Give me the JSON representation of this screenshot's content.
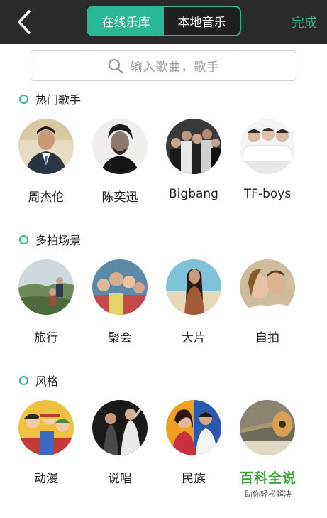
{
  "topbar": {
    "back_icon": "chevron-left-icon",
    "tabs": [
      {
        "label": "在线乐库",
        "active": true
      },
      {
        "label": "本地音乐",
        "active": false
      }
    ],
    "done_label": "完成"
  },
  "search": {
    "placeholder": "输入歌曲，歌手",
    "icon": "search-icon"
  },
  "sections": [
    {
      "title": "热门歌手",
      "items": [
        {
          "label": "周杰伦",
          "icon": "avatar-jay-chou"
        },
        {
          "label": "陈奕迅",
          "icon": "avatar-eason-chan"
        },
        {
          "label": "Bigbang",
          "icon": "avatar-bigbang"
        },
        {
          "label": "TF-boys",
          "icon": "avatar-tf-boys"
        }
      ]
    },
    {
      "title": "多拍场景",
      "items": [
        {
          "label": "旅行",
          "icon": "scene-travel"
        },
        {
          "label": "聚会",
          "icon": "scene-party"
        },
        {
          "label": "大片",
          "icon": "scene-blockbuster"
        },
        {
          "label": "自拍",
          "icon": "scene-selfie"
        }
      ]
    },
    {
      "title": "风格",
      "items": [
        {
          "label": "动漫",
          "icon": "style-anime"
        },
        {
          "label": "说唱",
          "icon": "style-rap"
        },
        {
          "label": "民族",
          "icon": "style-folk"
        },
        {
          "label": "",
          "icon": "style-guitar"
        }
      ]
    }
  ],
  "watermark": {
    "main": "百科全说",
    "sub": "助你轻松解决"
  },
  "colors": {
    "accent": "#28b894",
    "topbar": "#2a2a2a",
    "watermark": "#3aa63a"
  }
}
